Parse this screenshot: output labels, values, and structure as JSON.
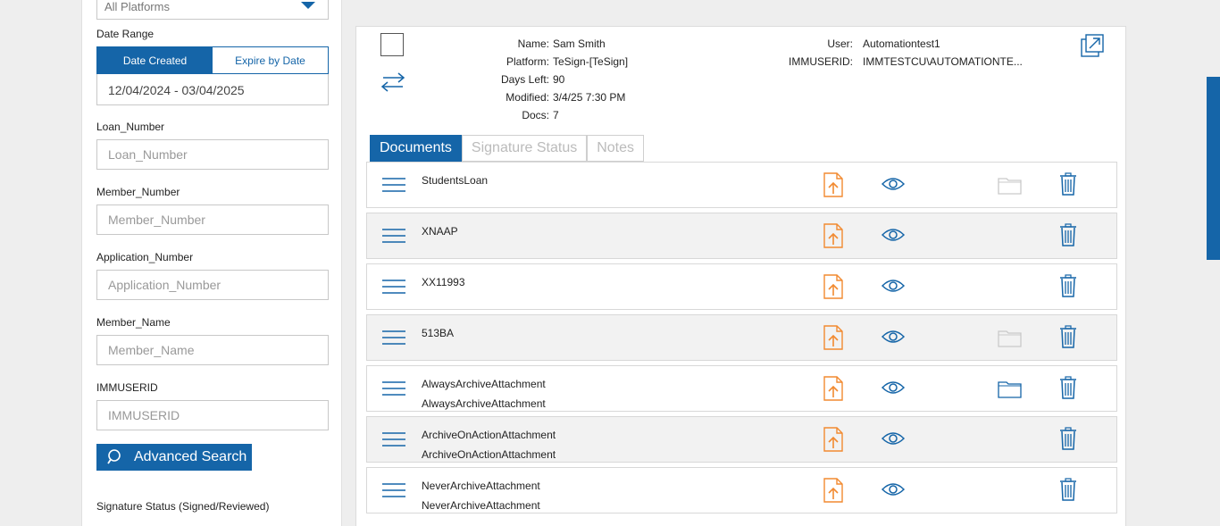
{
  "filters": {
    "platform_value": "All Platforms",
    "date_range_label": "Date Range",
    "date_tabs": {
      "created": "Date Created",
      "expire": "Expire by Date"
    },
    "date_range_value": "12/04/2024 - 03/04/2025",
    "fields": [
      {
        "label": "Loan_Number",
        "placeholder": "Loan_Number"
      },
      {
        "label": "Member_Number",
        "placeholder": "Member_Number"
      },
      {
        "label": "Application_Number",
        "placeholder": "Application_Number"
      },
      {
        "label": "Member_Name",
        "placeholder": "Member_Name"
      },
      {
        "label": "IMMUSERID",
        "placeholder": "IMMUSERID"
      }
    ],
    "advanced_search": "Advanced Search",
    "signature_status_label": "Signature Status (Signed/Reviewed)"
  },
  "package": {
    "labels": {
      "name": "Name:",
      "platform": "Platform:",
      "days_left": "Days Left:",
      "modified": "Modified:",
      "docs": "Docs:"
    },
    "values": {
      "name": "Sam Smith",
      "platform": "TeSign-[TeSign]",
      "days_left": "90",
      "modified": "3/4/25 7:30 PM",
      "docs": "7"
    },
    "user_labels": {
      "user": "User:",
      "immuserid": "IMMUSERID:"
    },
    "user_values": {
      "user": "Automationtest1",
      "immuserid": "IMMTESTCU\\AUTOMATIONTE..."
    }
  },
  "doc_tabs": {
    "documents": "Documents",
    "signature_status": "Signature Status",
    "notes": "Notes"
  },
  "documents": [
    {
      "line1": "StudentsLoan",
      "line2": "",
      "folder": "light"
    },
    {
      "line1": "XNAAP",
      "line2": "",
      "folder": "none"
    },
    {
      "line1": "XX11993",
      "line2": "",
      "folder": "none"
    },
    {
      "line1": "513BA",
      "line2": "",
      "folder": "light"
    },
    {
      "line1": "AlwaysArchiveAttachment",
      "line2": "AlwaysArchiveAttachment",
      "folder": "blue"
    },
    {
      "line1": "ArchiveOnActionAttachment",
      "line2": "ArchiveOnActionAttachment",
      "folder": "none"
    },
    {
      "line1": "NeverArchiveAttachment",
      "line2": "NeverArchiveAttachment",
      "folder": "none"
    }
  ],
  "colors": {
    "accent": "#1565a8",
    "upload": "#f28a30",
    "folder_light": "#c9c9c9"
  }
}
